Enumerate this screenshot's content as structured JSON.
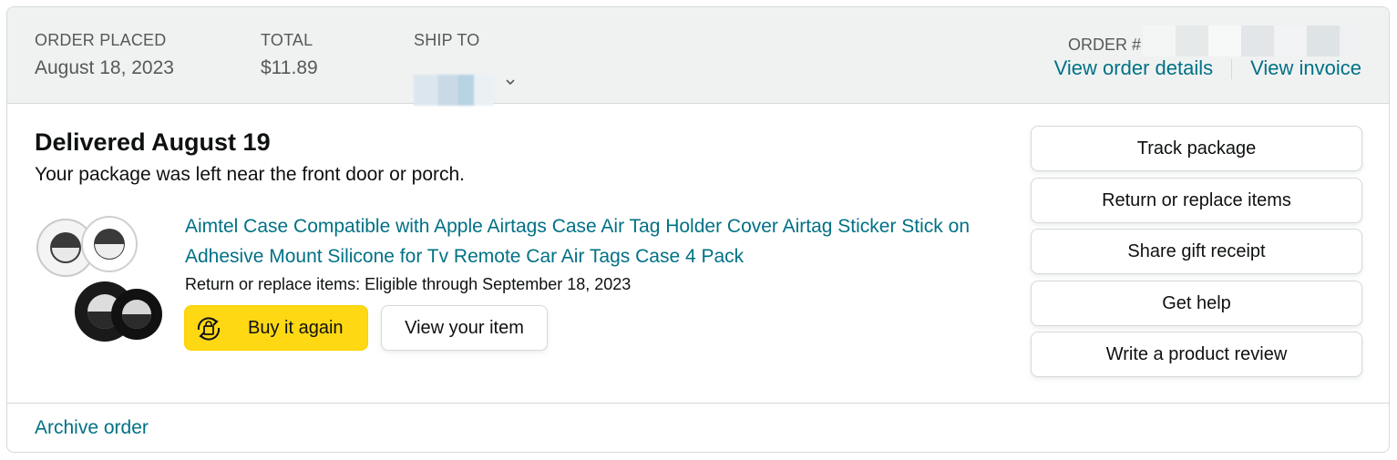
{
  "header": {
    "order_placed_label": "ORDER PLACED",
    "order_placed_value": "August 18, 2023",
    "total_label": "TOTAL",
    "total_value": "$11.89",
    "ship_to_label": "SHIP TO",
    "order_number_label": "ORDER #",
    "view_order_details": "View order details",
    "view_invoice": "View invoice"
  },
  "shipment": {
    "status_title": "Delivered August 19",
    "status_detail": "Your package was left near the front door or porch."
  },
  "item": {
    "title": "Aimtel Case Compatible with Apple Airtags Case Air Tag Holder Cover Airtag Sticker Stick on Adhesive Mount Silicone for Tv Remote Car Air Tags Case 4 Pack",
    "return_eligibility": "Return or replace items: Eligible through September 18, 2023",
    "buy_again_label": "Buy it again",
    "view_item_label": "View your item"
  },
  "actions": [
    {
      "label": "Track package"
    },
    {
      "label": "Return or replace items"
    },
    {
      "label": "Share gift receipt"
    },
    {
      "label": "Get help"
    },
    {
      "label": "Write a product review"
    }
  ],
  "footer": {
    "archive_label": "Archive order"
  },
  "colors": {
    "link": "#007185",
    "buy_button": "#ffd814",
    "header_bg": "#f0f2f2",
    "border": "#d5d9d9"
  },
  "icons": {
    "ship_dropdown": "chevron-down-icon",
    "buy_again": "reorder-cycle-icon"
  }
}
